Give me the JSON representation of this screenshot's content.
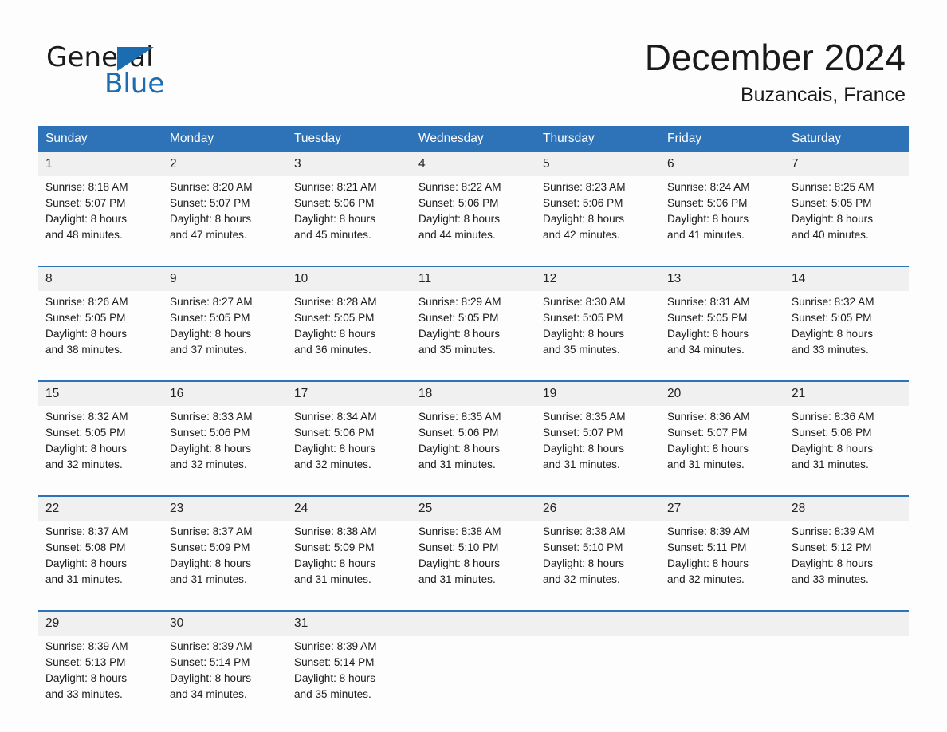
{
  "logo": {
    "word_one": "General",
    "word_two": "Blue",
    "accent_color": "#1b6cb0",
    "triangle_icon": "triangle-icon"
  },
  "header": {
    "month_title": "December 2024",
    "location": "Buzancais, France",
    "header_bg_color": "#2e72b8",
    "date_band_color": "#f0f0f0"
  },
  "calendar": {
    "weekday_headers": [
      "Sunday",
      "Monday",
      "Tuesday",
      "Wednesday",
      "Thursday",
      "Friday",
      "Saturday"
    ],
    "weeks": [
      [
        {
          "day": "1",
          "sunrise": "Sunrise: 8:18 AM",
          "sunset": "Sunset: 5:07 PM",
          "daylight_1": "Daylight: 8 hours",
          "daylight_2": "and 48 minutes."
        },
        {
          "day": "2",
          "sunrise": "Sunrise: 8:20 AM",
          "sunset": "Sunset: 5:07 PM",
          "daylight_1": "Daylight: 8 hours",
          "daylight_2": "and 47 minutes."
        },
        {
          "day": "3",
          "sunrise": "Sunrise: 8:21 AM",
          "sunset": "Sunset: 5:06 PM",
          "daylight_1": "Daylight: 8 hours",
          "daylight_2": "and 45 minutes."
        },
        {
          "day": "4",
          "sunrise": "Sunrise: 8:22 AM",
          "sunset": "Sunset: 5:06 PM",
          "daylight_1": "Daylight: 8 hours",
          "daylight_2": "and 44 minutes."
        },
        {
          "day": "5",
          "sunrise": "Sunrise: 8:23 AM",
          "sunset": "Sunset: 5:06 PM",
          "daylight_1": "Daylight: 8 hours",
          "daylight_2": "and 42 minutes."
        },
        {
          "day": "6",
          "sunrise": "Sunrise: 8:24 AM",
          "sunset": "Sunset: 5:06 PM",
          "daylight_1": "Daylight: 8 hours",
          "daylight_2": "and 41 minutes."
        },
        {
          "day": "7",
          "sunrise": "Sunrise: 8:25 AM",
          "sunset": "Sunset: 5:05 PM",
          "daylight_1": "Daylight: 8 hours",
          "daylight_2": "and 40 minutes."
        }
      ],
      [
        {
          "day": "8",
          "sunrise": "Sunrise: 8:26 AM",
          "sunset": "Sunset: 5:05 PM",
          "daylight_1": "Daylight: 8 hours",
          "daylight_2": "and 38 minutes."
        },
        {
          "day": "9",
          "sunrise": "Sunrise: 8:27 AM",
          "sunset": "Sunset: 5:05 PM",
          "daylight_1": "Daylight: 8 hours",
          "daylight_2": "and 37 minutes."
        },
        {
          "day": "10",
          "sunrise": "Sunrise: 8:28 AM",
          "sunset": "Sunset: 5:05 PM",
          "daylight_1": "Daylight: 8 hours",
          "daylight_2": "and 36 minutes."
        },
        {
          "day": "11",
          "sunrise": "Sunrise: 8:29 AM",
          "sunset": "Sunset: 5:05 PM",
          "daylight_1": "Daylight: 8 hours",
          "daylight_2": "and 35 minutes."
        },
        {
          "day": "12",
          "sunrise": "Sunrise: 8:30 AM",
          "sunset": "Sunset: 5:05 PM",
          "daylight_1": "Daylight: 8 hours",
          "daylight_2": "and 35 minutes."
        },
        {
          "day": "13",
          "sunrise": "Sunrise: 8:31 AM",
          "sunset": "Sunset: 5:05 PM",
          "daylight_1": "Daylight: 8 hours",
          "daylight_2": "and 34 minutes."
        },
        {
          "day": "14",
          "sunrise": "Sunrise: 8:32 AM",
          "sunset": "Sunset: 5:05 PM",
          "daylight_1": "Daylight: 8 hours",
          "daylight_2": "and 33 minutes."
        }
      ],
      [
        {
          "day": "15",
          "sunrise": "Sunrise: 8:32 AM",
          "sunset": "Sunset: 5:05 PM",
          "daylight_1": "Daylight: 8 hours",
          "daylight_2": "and 32 minutes."
        },
        {
          "day": "16",
          "sunrise": "Sunrise: 8:33 AM",
          "sunset": "Sunset: 5:06 PM",
          "daylight_1": "Daylight: 8 hours",
          "daylight_2": "and 32 minutes."
        },
        {
          "day": "17",
          "sunrise": "Sunrise: 8:34 AM",
          "sunset": "Sunset: 5:06 PM",
          "daylight_1": "Daylight: 8 hours",
          "daylight_2": "and 32 minutes."
        },
        {
          "day": "18",
          "sunrise": "Sunrise: 8:35 AM",
          "sunset": "Sunset: 5:06 PM",
          "daylight_1": "Daylight: 8 hours",
          "daylight_2": "and 31 minutes."
        },
        {
          "day": "19",
          "sunrise": "Sunrise: 8:35 AM",
          "sunset": "Sunset: 5:07 PM",
          "daylight_1": "Daylight: 8 hours",
          "daylight_2": "and 31 minutes."
        },
        {
          "day": "20",
          "sunrise": "Sunrise: 8:36 AM",
          "sunset": "Sunset: 5:07 PM",
          "daylight_1": "Daylight: 8 hours",
          "daylight_2": "and 31 minutes."
        },
        {
          "day": "21",
          "sunrise": "Sunrise: 8:36 AM",
          "sunset": "Sunset: 5:08 PM",
          "daylight_1": "Daylight: 8 hours",
          "daylight_2": "and 31 minutes."
        }
      ],
      [
        {
          "day": "22",
          "sunrise": "Sunrise: 8:37 AM",
          "sunset": "Sunset: 5:08 PM",
          "daylight_1": "Daylight: 8 hours",
          "daylight_2": "and 31 minutes."
        },
        {
          "day": "23",
          "sunrise": "Sunrise: 8:37 AM",
          "sunset": "Sunset: 5:09 PM",
          "daylight_1": "Daylight: 8 hours",
          "daylight_2": "and 31 minutes."
        },
        {
          "day": "24",
          "sunrise": "Sunrise: 8:38 AM",
          "sunset": "Sunset: 5:09 PM",
          "daylight_1": "Daylight: 8 hours",
          "daylight_2": "and 31 minutes."
        },
        {
          "day": "25",
          "sunrise": "Sunrise: 8:38 AM",
          "sunset": "Sunset: 5:10 PM",
          "daylight_1": "Daylight: 8 hours",
          "daylight_2": "and 31 minutes."
        },
        {
          "day": "26",
          "sunrise": "Sunrise: 8:38 AM",
          "sunset": "Sunset: 5:10 PM",
          "daylight_1": "Daylight: 8 hours",
          "daylight_2": "and 32 minutes."
        },
        {
          "day": "27",
          "sunrise": "Sunrise: 8:39 AM",
          "sunset": "Sunset: 5:11 PM",
          "daylight_1": "Daylight: 8 hours",
          "daylight_2": "and 32 minutes."
        },
        {
          "day": "28",
          "sunrise": "Sunrise: 8:39 AM",
          "sunset": "Sunset: 5:12 PM",
          "daylight_1": "Daylight: 8 hours",
          "daylight_2": "and 33 minutes."
        }
      ],
      [
        {
          "day": "29",
          "sunrise": "Sunrise: 8:39 AM",
          "sunset": "Sunset: 5:13 PM",
          "daylight_1": "Daylight: 8 hours",
          "daylight_2": "and 33 minutes."
        },
        {
          "day": "30",
          "sunrise": "Sunrise: 8:39 AM",
          "sunset": "Sunset: 5:14 PM",
          "daylight_1": "Daylight: 8 hours",
          "daylight_2": "and 34 minutes."
        },
        {
          "day": "31",
          "sunrise": "Sunrise: 8:39 AM",
          "sunset": "Sunset: 5:14 PM",
          "daylight_1": "Daylight: 8 hours",
          "daylight_2": "and 35 minutes."
        },
        {
          "day": "",
          "sunrise": "",
          "sunset": "",
          "daylight_1": "",
          "daylight_2": ""
        },
        {
          "day": "",
          "sunrise": "",
          "sunset": "",
          "daylight_1": "",
          "daylight_2": ""
        },
        {
          "day": "",
          "sunrise": "",
          "sunset": "",
          "daylight_1": "",
          "daylight_2": ""
        },
        {
          "day": "",
          "sunrise": "",
          "sunset": "",
          "daylight_1": "",
          "daylight_2": ""
        }
      ]
    ]
  }
}
